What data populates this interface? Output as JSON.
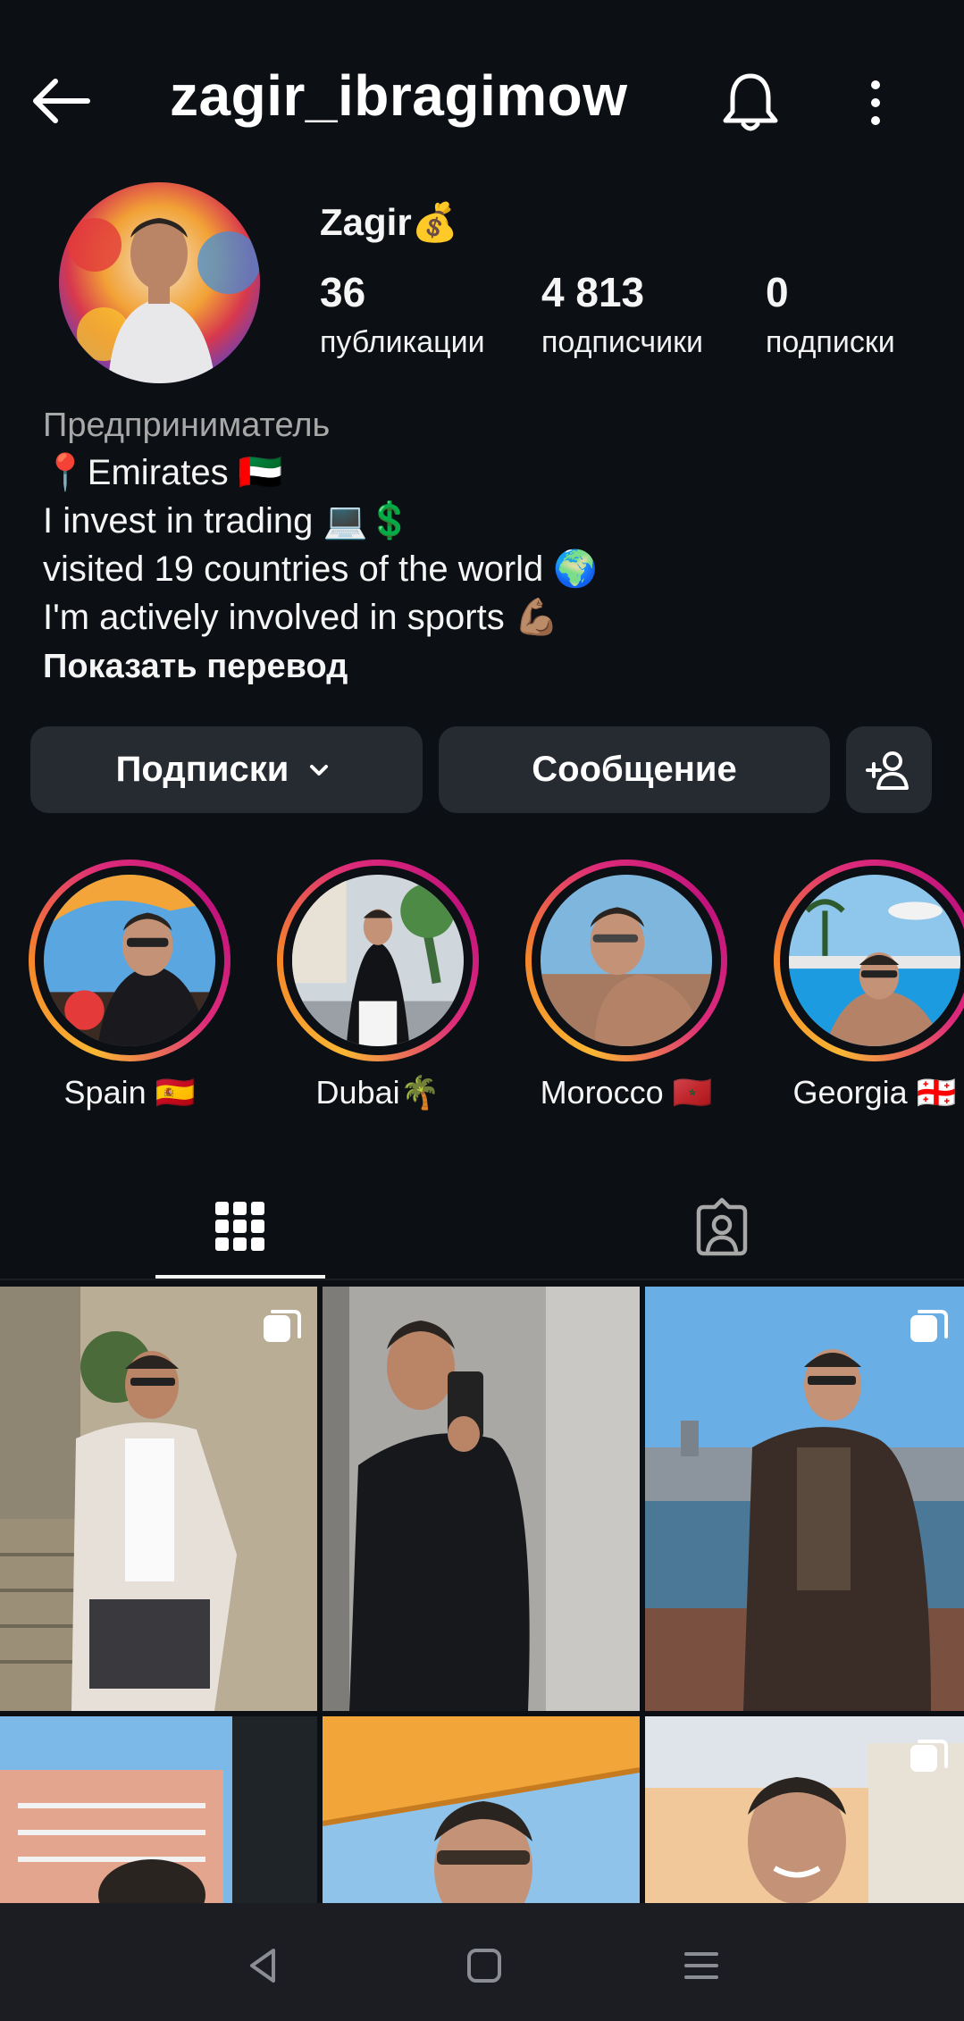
{
  "header": {
    "username": "zagir_ibragimow"
  },
  "profile": {
    "display_name": "Zagir💰",
    "stats": [
      {
        "count": "36",
        "label": "публикации"
      },
      {
        "count": "4 813",
        "label": "подписчики"
      },
      {
        "count": "0",
        "label": "подписки"
      }
    ],
    "bio": {
      "category": "Предприниматель",
      "lines": [
        "📍Emirates 🇦🇪",
        "I invest in trading 💻💲",
        "visited 19 countries of the world 🌍",
        "I'm actively involved in sports 💪🏽"
      ],
      "translate_label": "Показать перевод"
    }
  },
  "actions": {
    "following_label": "Подписки",
    "message_label": "Сообщение",
    "add_user_icon": "add-person-icon"
  },
  "highlights": [
    {
      "label": "Spain 🇪🇸"
    },
    {
      "label": "Dubai🌴"
    },
    {
      "label": "Morocco 🇲🇦"
    },
    {
      "label": "Georgia 🇬🇪"
    }
  ],
  "tabs": [
    {
      "icon": "grid-icon",
      "active": true
    },
    {
      "icon": "tagged-person-icon",
      "active": false
    }
  ],
  "colors": {
    "background": "#0c0f14",
    "button": "#262a31",
    "ring_gradient": [
      "#f9b633",
      "#f58529",
      "#dd2a7b",
      "#c0137c"
    ],
    "secondary_text": "#a8a8a8"
  },
  "navbar": {
    "icons": [
      "back-triangle-icon",
      "home-square-icon",
      "recents-menu-icon"
    ]
  }
}
